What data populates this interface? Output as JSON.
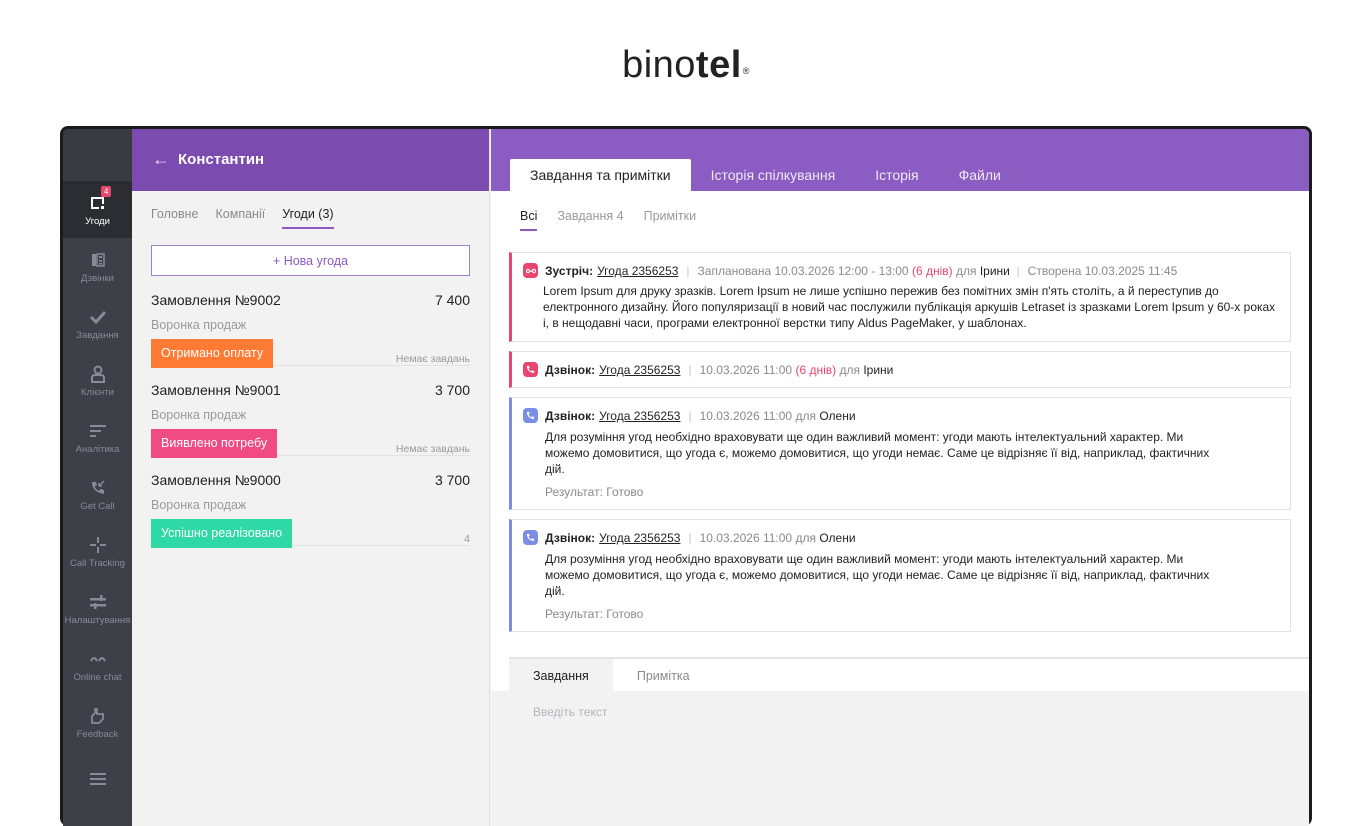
{
  "logo": {
    "text_light": "bino",
    "text_bold": "tel",
    "mark": "®"
  },
  "rail": {
    "items": [
      {
        "label": "Угоди",
        "icon": "deals-icon",
        "badge": "4",
        "active": true
      },
      {
        "label": "Дзвінки",
        "icon": "calls-icon"
      },
      {
        "label": "Завдання",
        "icon": "check-icon"
      },
      {
        "label": "Клієнти",
        "icon": "user-icon"
      },
      {
        "label": "Аналітика",
        "icon": "analytics-icon"
      },
      {
        "label": "Get Call",
        "icon": "get-call-icon"
      },
      {
        "label": "Call Tracking",
        "icon": "call-tracking-icon"
      },
      {
        "label": "Налаштування",
        "icon": "settings-icon"
      },
      {
        "label": "Online chat",
        "icon": "chat-icon"
      },
      {
        "label": "Feedback",
        "icon": "feedback-icon"
      }
    ]
  },
  "contact": {
    "back_arrow": "←",
    "name": "Константин",
    "tabs": [
      "Головне",
      "Компанії",
      "Угоди (3)"
    ],
    "active_tab": 2,
    "new_deal": "+ Нова угода",
    "deals": [
      {
        "title": "Замовлення №9002",
        "amount": "7 400",
        "funnel": "Воронка продаж",
        "status": "Отримано оплату",
        "status_color": "#ff7a33",
        "tasks": "Немає завдань"
      },
      {
        "title": "Замовлення №9001",
        "amount": "3 700",
        "funnel": "Воронка продаж",
        "status": "Виявлено потребу",
        "status_color": "#f04b82",
        "tasks": "Немає завдань"
      },
      {
        "title": "Замовлення №9000",
        "amount": "3 700",
        "funnel": "Воронка продаж",
        "status": "Успішно реалізовано",
        "status_color": "#2ed9a6",
        "tasks": "4"
      }
    ]
  },
  "main": {
    "tabs": [
      "Завдання та примітки",
      "Історія спілкування",
      "Історія",
      "Файли"
    ],
    "active_tab": 0,
    "subtabs": [
      "Всі",
      "Завдання 4",
      "Примітки"
    ],
    "active_subtab": 0,
    "feed": [
      {
        "type": "Зустріч:",
        "deal": "Угода 2356253",
        "planned": "Запланована 10.03.2026 12:00 - 13:00",
        "days": "(6 днів)",
        "for": "для",
        "person": "Ірини",
        "created": "Створена 10.03.2025 11:45",
        "body": "Lorem Ipsum для друку зразків. Lorem Ipsum не лише успішно пережив без помітних змін п'ять століть, а й переступив до електронного дизайну. Його популяризації в новий час послужили публікація аркушів Letraset із зразками Lorem Ipsum у 60-х роках і, в нещодавні часи, програми електронної верстки типу Aldus PageMaker, у шаблонах."
      },
      {
        "type": "Дзвінок:",
        "deal": "Угода 2356253",
        "planned": "10.03.2026 11:00",
        "days": "(6 днів)",
        "for": "для",
        "person": "Ірини"
      },
      {
        "type": "Дзвінок:",
        "deal": "Угода 2356253",
        "planned": "10.03.2026 11:00",
        "for": "для",
        "person": "Олени",
        "body": "Для розуміння угод необхідно враховувати ще один важливий момент: угоди мають інтелектуальний характер. Ми можемо домовитися, що угода є, можемо домовитися, що угоди немає. Саме це відрізняє її від, наприклад, фактичних дій.",
        "result": "Результат: Готово"
      },
      {
        "type": "Дзвінок:",
        "deal": "Угода 2356253",
        "planned": "10.03.2026 11:00",
        "for": "для",
        "person": "Олени",
        "body": "Для розуміння угод необхідно враховувати ще один важливий момент: угоди мають інтелектуальний характер. Ми можемо домовитися, що угода є, можемо домовитися, що угоди немає. Саме це відрізняє її від, наприклад, фактичних дій.",
        "result": "Результат: Готово"
      }
    ],
    "compose_tabs": [
      "Завдання",
      "Примітка"
    ],
    "compose_active": 0,
    "compose_placeholder": "Введіть текст"
  },
  "colors": {
    "purple_dark": "#7b4bb0",
    "purple": "#8b5cc2",
    "pink": "#e8456f",
    "blue": "#7c8de6"
  }
}
